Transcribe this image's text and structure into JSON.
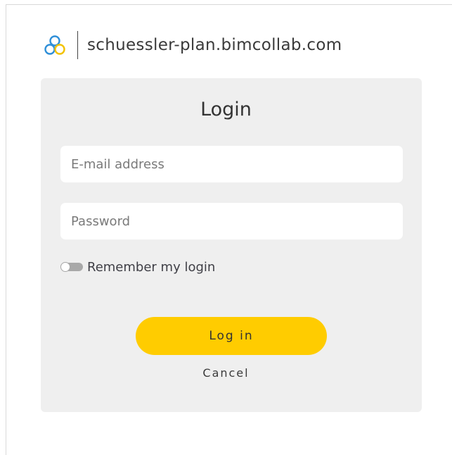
{
  "header": {
    "logo_icon": "bimcollab-logo-icon",
    "domain": "schuessler-plan.bimcollab.com"
  },
  "login": {
    "title": "Login",
    "email_placeholder": "E-mail address",
    "email_value": "",
    "password_placeholder": "Password",
    "password_value": "",
    "remember_label": "Remember my login",
    "remember_checked": false,
    "login_button": "Log in",
    "cancel_link": "Cancel"
  },
  "colors": {
    "accent": "#ffcc00",
    "card_bg": "#efefef",
    "logo_blue": "#2f8fd8",
    "logo_yellow": "#f2c200"
  }
}
